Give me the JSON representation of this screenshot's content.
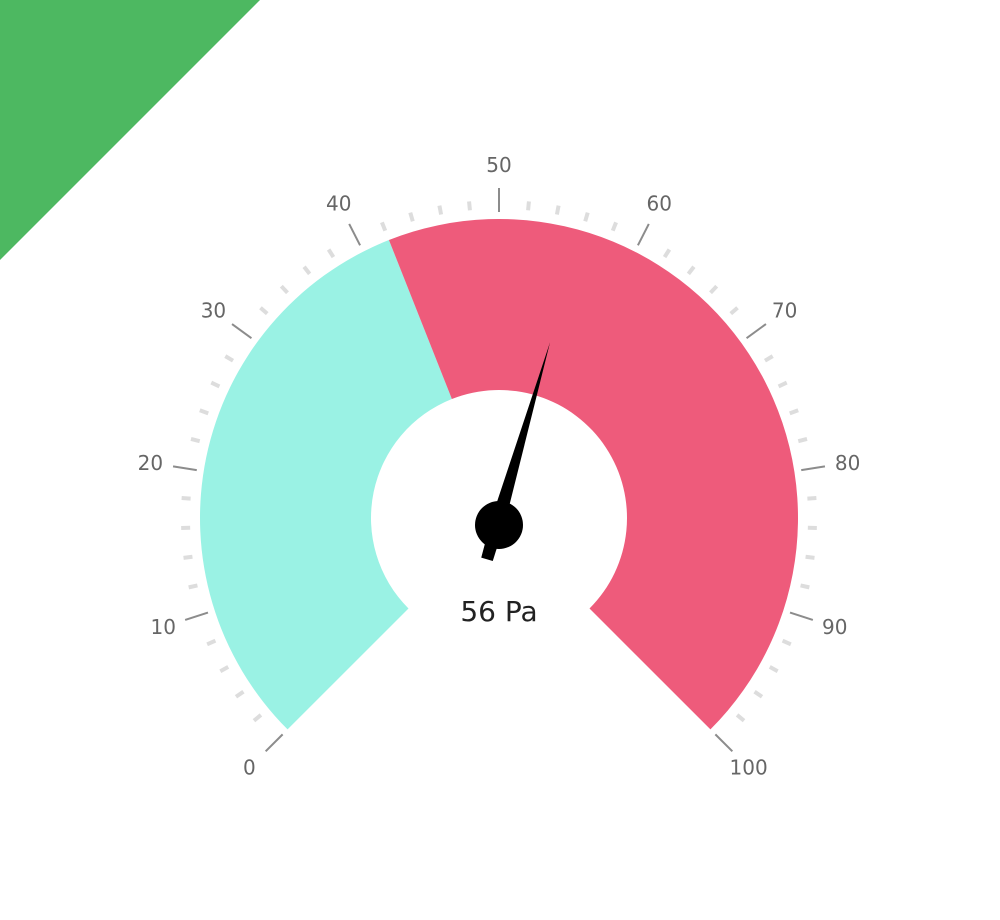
{
  "colors": {
    "ribbon": "#4db861",
    "low_band": "#9af2e4",
    "high_band": "#ee5b7b",
    "needle": "#000000",
    "major_tick": "#8c8c8c",
    "minor_tick": "#dddddd"
  },
  "chart_data": {
    "type": "gauge",
    "min": 0,
    "max": 100,
    "value": 56,
    "unit": "Pa",
    "value_label": "56 Pa",
    "major_ticks": [
      0,
      10,
      20,
      30,
      40,
      50,
      60,
      70,
      80,
      90,
      100
    ],
    "tick_labels": [
      "0",
      "10",
      "20",
      "30",
      "40",
      "50",
      "60",
      "70",
      "80",
      "90",
      "100"
    ],
    "minor_tick_step": 2,
    "bands": [
      {
        "from": 0,
        "to": 42,
        "color": "#9af2e4"
      },
      {
        "from": 42,
        "to": 100,
        "color": "#ee5b7b"
      }
    ]
  }
}
